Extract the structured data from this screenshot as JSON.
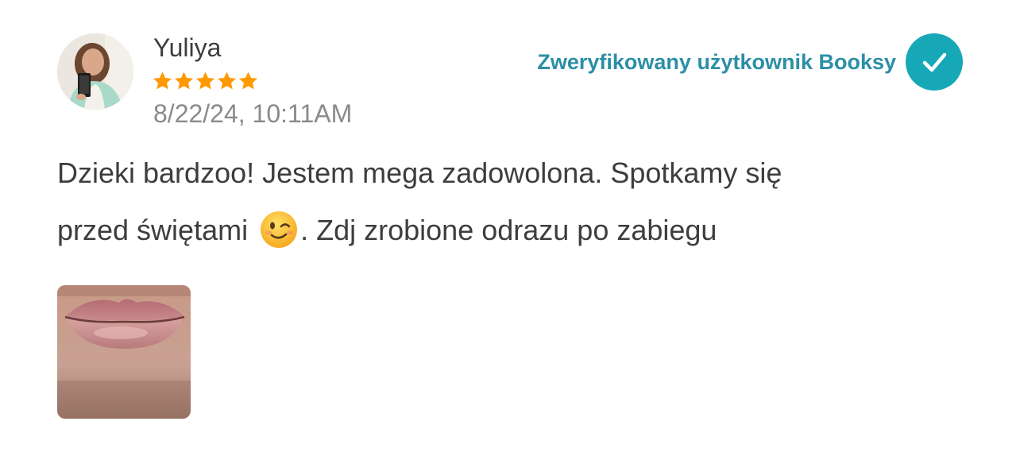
{
  "review": {
    "reviewer_name": "Yuliya",
    "rating": 5,
    "rating_max": 5,
    "date": "8/22/24, 10:11AM",
    "verified_label": "Zweryfikowany użytkownik Booksy",
    "text_line1": "Dzieki bardzoo! Jestem mega zadowolona. Spotkamy się",
    "text_line2_before_emoji": "przed świętami",
    "emoji": "winking-face-emoji",
    "text_line2_after_emoji": ". Zdj zrobione odrazu po zabiegu",
    "photo": "lips-photo"
  },
  "colors": {
    "star": "#ff9900",
    "verified_text": "#2b8fa6",
    "verified_badge": "#17a8b7",
    "name_text": "#3d3d3d",
    "date_text": "#8a8a8a"
  },
  "icons": {
    "avatar": "user-avatar-photo",
    "star": "star-icon",
    "verified": "checkmark-icon"
  }
}
